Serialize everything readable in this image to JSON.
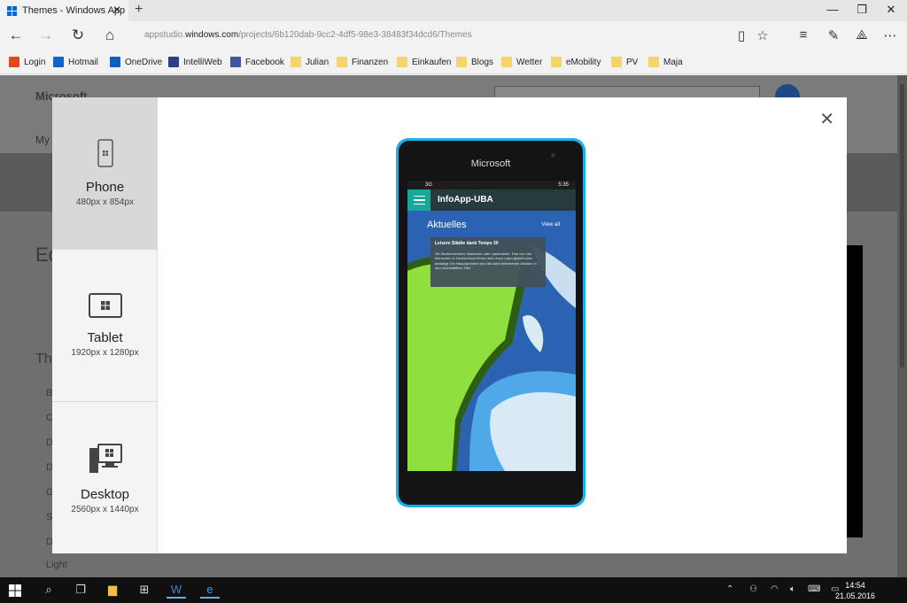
{
  "browser": {
    "tab_title": "Themes - Windows App",
    "tab_close": "✕",
    "new_tab": "+",
    "url_prefix": "appstudio.",
    "url_domain": "windows.com",
    "url_path": "/projects/6b120dab-9cc2-4df5-98e3-38483f34dcd6/Themes",
    "window_controls": [
      "—",
      "❐",
      "✕"
    ]
  },
  "favorites": [
    {
      "label": "Login",
      "color": "#e04a1a"
    },
    {
      "label": "Hotmail",
      "color": "#0a67c9"
    },
    {
      "label": "OneDrive",
      "color": "#0a5fbf"
    },
    {
      "label": "IntelliWeb",
      "color": "#2a3f8a"
    },
    {
      "label": "Facebook",
      "color": "#3b5998"
    },
    {
      "label": "Julian",
      "color": "#f5d46b"
    },
    {
      "label": "Finanzen",
      "color": "#f5d46b"
    },
    {
      "label": "Einkaufen",
      "color": "#f5d46b"
    },
    {
      "label": "Blogs",
      "color": "#f5d46b"
    },
    {
      "label": "Wetter",
      "color": "#f5d46b"
    },
    {
      "label": "eMobility",
      "color": "#f5d46b"
    },
    {
      "label": "PV",
      "color": "#f5d46b"
    },
    {
      "label": "Maja",
      "color": "#f5d46b"
    }
  ],
  "background_page": {
    "logo": "Microsoft",
    "my": "My",
    "ed": "Ed",
    "th": "Th",
    "letters": [
      "B",
      "C",
      "D",
      "D",
      "G",
      "S",
      "D"
    ],
    "light": "Light"
  },
  "modal": {
    "close": "✕",
    "devices": [
      {
        "name": "Phone",
        "size": "480px x 854px",
        "active": true
      },
      {
        "name": "Tablet",
        "size": "1920px x 1280px",
        "active": false
      },
      {
        "name": "Desktop",
        "size": "2560px x 1440px",
        "active": false
      }
    ]
  },
  "phone": {
    "brand": "Microsoft",
    "status_left": "3G",
    "status_time": "5:35",
    "app_title": "InfoApp-UBA",
    "section_title": "Aktuelles",
    "view_all": "View all",
    "card_title": "Leisere Städte dank Tempo 30",
    "card_text": "Ob Straßenverkehr, Nachbarn oder Laubenkehr. Drei von vier Menschen in Deutschland fühlen sich durch Lärm gestört oder belästigt. Ein Hauptproblem sind die stark befahrenen Straßen in den Innenstädten. Hier"
  },
  "taskbar": {
    "time": "14:54",
    "date": "21.05.2016"
  },
  "colors": {
    "accent": "#1ab0e8",
    "appbar": "#283b3c",
    "hamburger": "#16a99a",
    "art_green": "#8fe03c"
  }
}
